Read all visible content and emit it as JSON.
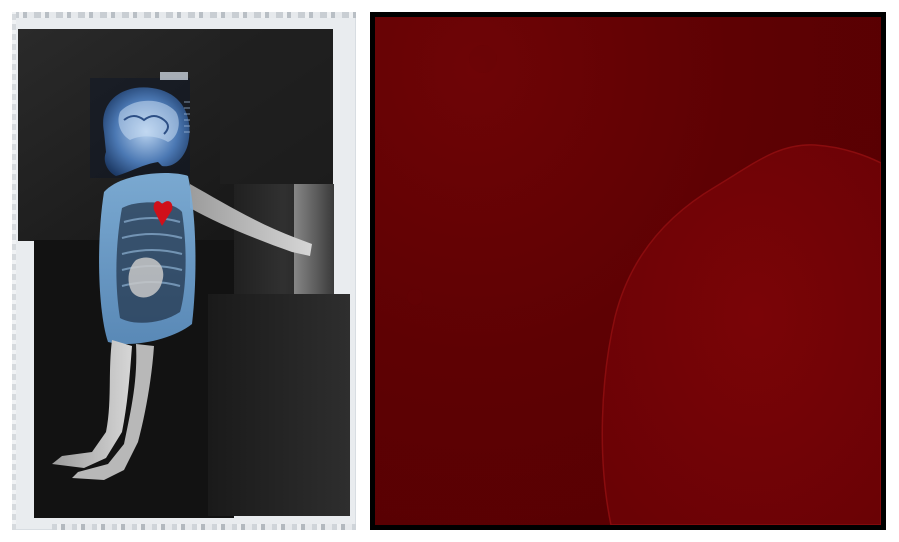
{
  "artwork": {
    "left_panel": {
      "description_key": "collage",
      "colors": {
        "mat": "#e9ecef",
        "dark_block": "#1c1c1c",
        "mid_block": "#2b2b2b",
        "xray_blue": "#6f9fcf",
        "heart_red": "#d0101a"
      }
    },
    "right_panel": {
      "colors": {
        "frame": "#000000",
        "field": "#5e0103",
        "blob": "#730306",
        "blob_edge": "#8a0c0e"
      }
    }
  }
}
